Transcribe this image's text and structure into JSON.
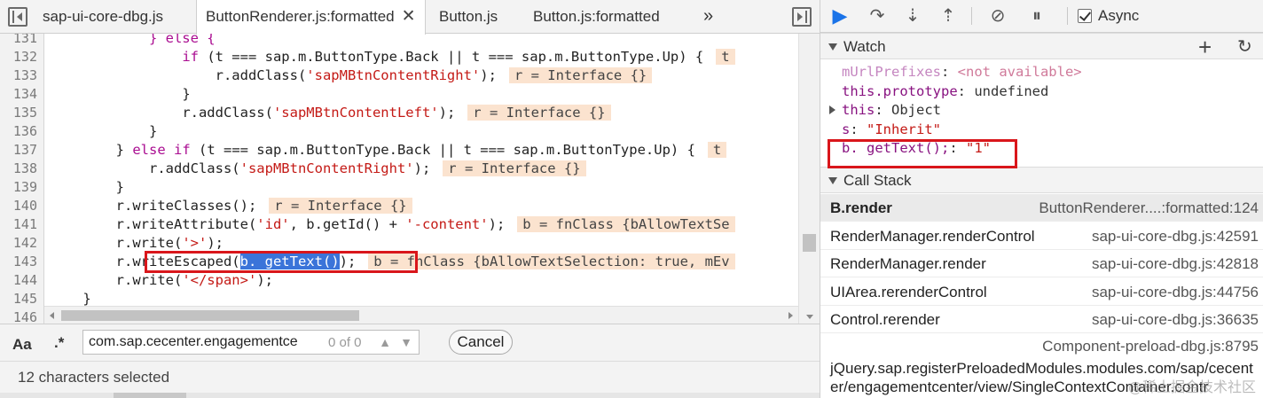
{
  "editor": {
    "tabs": [
      {
        "label": "sap-ui-core-dbg.js",
        "active": false
      },
      {
        "label": "ButtonRenderer.js:formatted",
        "active": true,
        "close": "✕"
      },
      {
        "label": "Button.js",
        "active": false
      },
      {
        "label": "Button.js:formatted",
        "active": false
      }
    ],
    "overflow": "»",
    "lines": [
      {
        "n": "131",
        "indent": "            ",
        "parts": [
          [
            "kw",
            "} else {"
          ]
        ]
      },
      {
        "n": "132",
        "indent": "                ",
        "parts": [
          [
            "kw",
            "if"
          ],
          [
            "",
            " (t === sap.m.ButtonType.Back || t === sap.m.ButtonType.Up) {"
          ],
          [
            "inl",
            "t"
          ]
        ]
      },
      {
        "n": "133",
        "indent": "                    ",
        "parts": [
          [
            "",
            "r.addClass("
          ],
          [
            "str",
            "'sapMBtnContentRight'"
          ],
          [
            "",
            ");"
          ],
          [
            "inl",
            "r = Interface {}"
          ]
        ]
      },
      {
        "n": "134",
        "indent": "                ",
        "parts": [
          [
            "",
            "}"
          ]
        ]
      },
      {
        "n": "135",
        "indent": "                ",
        "parts": [
          [
            "",
            "r.addClass("
          ],
          [
            "str",
            "'sapMBtnContentLeft'"
          ],
          [
            "",
            ");"
          ],
          [
            "inl",
            "r = Interface {}"
          ]
        ]
      },
      {
        "n": "136",
        "indent": "            ",
        "parts": [
          [
            "",
            "}"
          ]
        ]
      },
      {
        "n": "137",
        "indent": "        ",
        "parts": [
          [
            "",
            "} "
          ],
          [
            "kw",
            "else if"
          ],
          [
            "",
            " (t === sap.m.ButtonType.Back || t === sap.m.ButtonType.Up) {"
          ],
          [
            "inl",
            "t"
          ]
        ]
      },
      {
        "n": "138",
        "indent": "            ",
        "parts": [
          [
            "",
            "r.addClass("
          ],
          [
            "str",
            "'sapMBtnContentRight'"
          ],
          [
            "",
            ");"
          ],
          [
            "inl",
            "r = Interface {}"
          ]
        ]
      },
      {
        "n": "139",
        "indent": "        ",
        "parts": [
          [
            "",
            "}"
          ]
        ]
      },
      {
        "n": "140",
        "indent": "        ",
        "parts": [
          [
            "",
            "r.writeClasses();"
          ],
          [
            "inl",
            "r = Interface {}"
          ]
        ]
      },
      {
        "n": "141",
        "indent": "        ",
        "parts": [
          [
            "",
            "r.writeAttribute("
          ],
          [
            "str",
            "'id'"
          ],
          [
            "",
            ", b.getId() + "
          ],
          [
            "str",
            "'-content'"
          ],
          [
            "",
            ");"
          ],
          [
            "inl",
            "b = fnClass {bAllowTextSe"
          ]
        ]
      },
      {
        "n": "142",
        "indent": "        ",
        "parts": [
          [
            "",
            "r.write("
          ],
          [
            "str",
            "'>'"
          ],
          [
            "",
            ");"
          ]
        ]
      },
      {
        "n": "143",
        "indent": "        ",
        "parts": [
          [
            "",
            "r.writeEscaped("
          ],
          [
            "sel",
            "b. getText()"
          ],
          [
            "",
            ");"
          ],
          [
            "inl",
            "b = fnClass {bAllowTextSelection: true, mEv"
          ]
        ]
      },
      {
        "n": "144",
        "indent": "        ",
        "parts": [
          [
            "",
            "r.write("
          ],
          [
            "str",
            "'</span>'"
          ],
          [
            "",
            ");"
          ]
        ]
      },
      {
        "n": "145",
        "indent": "    ",
        "parts": [
          [
            "",
            "}"
          ]
        ]
      },
      {
        "n": "146",
        "indent": "",
        "parts": [
          [
            "",
            ""
          ]
        ]
      }
    ]
  },
  "search": {
    "aa_label": "Aa",
    "regex_label": ".*",
    "value": "com.sap.cecenter.engagementce",
    "match_count": "0 of 0",
    "prev": "▲",
    "next": "▼",
    "cancel_label": "Cancel"
  },
  "status": {
    "text": "12 characters selected"
  },
  "debugger": {
    "toolbar": {
      "resume_icon": "▶",
      "step_over_icon": "↷",
      "step_into_icon": "⇣",
      "step_out_icon": "⇡",
      "deactivate_icon": "⊘",
      "pause_exceptions_icon": "⏸",
      "async_label": "Async"
    },
    "watch": {
      "title": "Watch",
      "add_icon": "+",
      "refresh_icon": "↻",
      "items": [
        {
          "name": "mUrlPrefixes",
          "value": "<not available>",
          "dim": true,
          "string": false
        },
        {
          "name": "this.prototype",
          "value": "undefined",
          "dim": false,
          "string": false
        },
        {
          "name": "this",
          "value": "Object",
          "dim": false,
          "string": false,
          "expandable": true
        },
        {
          "name": "s",
          "value": "\"Inherit\"",
          "dim": false,
          "string": true
        },
        {
          "name": "b. getText();",
          "value": "\"1\"",
          "dim": false,
          "string": true
        }
      ]
    },
    "call_stack": {
      "title": "Call Stack",
      "frames": [
        {
          "fn": "B.render",
          "loc": "ButtonRenderer....:formatted:124",
          "selected": true
        },
        {
          "fn": "RenderManager.renderControl",
          "loc": "sap-ui-core-dbg.js:42591"
        },
        {
          "fn": "RenderManager.render",
          "loc": "sap-ui-core-dbg.js:42818"
        },
        {
          "fn": "UIArea.rerenderControl",
          "loc": "sap-ui-core-dbg.js:44756"
        },
        {
          "fn": "Control.rerender",
          "loc": "sap-ui-core-dbg.js:36635"
        }
      ],
      "extra_loc": "Component-preload-dbg.js:8795",
      "extra_fn": "jQuery.sap.registerPreloadedModules.modules.com/sap/cecenter/engagementcenter/view/SingleContextContainer.contr"
    },
    "watermark": "@稀土掘金技术社区"
  }
}
